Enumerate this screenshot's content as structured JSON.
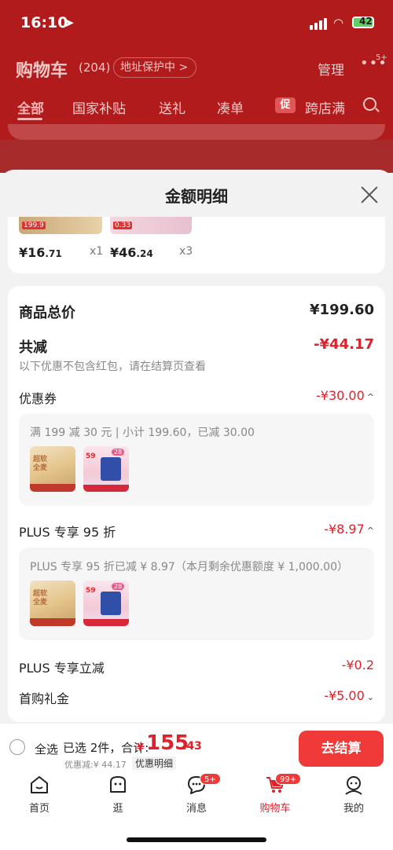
{
  "status": {
    "time": "16:10",
    "battery": "42"
  },
  "header": {
    "title": "购物车",
    "count": "(204)",
    "addr_pill": "地址保护中 >",
    "manage": "管理",
    "more_badge": "5+"
  },
  "tabs": [
    "全部",
    "国家补贴",
    "送礼",
    "凑单",
    "促",
    "跨店满"
  ],
  "sheet": {
    "title": "金额明细"
  },
  "items": [
    {
      "thumb_label": "199.9",
      "price_int": "¥16",
      "price_dec": ".71",
      "qty": "x1"
    },
    {
      "thumb_label": "0.33",
      "price_int": "¥46",
      "price_dec": ".24",
      "qty": "x3"
    }
  ],
  "summary": {
    "total_label": "商品总价",
    "total_value": "¥199.60",
    "reduce_label": "共减",
    "reduce_value": "-¥44.17",
    "reduce_note": "以下优惠不包含红包，请在结算页查看",
    "coupon_label": "优惠券",
    "coupon_value": "-¥30.00",
    "coupon_detail": "满 199 减 30 元 | 小计 199.60，已减 30.00",
    "plus_label": "PLUS 专享 95 折",
    "plus_value": "-¥8.97",
    "plus_detail": "PLUS 专享 95 折已减 ¥ 8.97（本月剩余优惠额度 ¥ 1,000.00）",
    "plus_cut_label": "PLUS 专享立减",
    "plus_cut_value": "-¥0.2",
    "first_gift_label": "首购礼金",
    "first_gift_value": "-¥5.00"
  },
  "product_thumbs": {
    "bread_text": "超软\n全麦",
    "milk_tag": "59",
    "milk_tag2": "28"
  },
  "bottom": {
    "select_all": "全选",
    "selected": "已选 2件，合计:",
    "total_sym": "¥",
    "total_int": "155",
    "total_dec": ".43",
    "discount": "优惠减:¥ 44.17",
    "detail_link": "优惠明细",
    "checkout": "去结算"
  },
  "tabbar": [
    {
      "label": "首页",
      "icon": "home-icon"
    },
    {
      "label": "逛",
      "icon": "browse-icon"
    },
    {
      "label": "消息",
      "icon": "message-icon",
      "badge": "5+"
    },
    {
      "label": "购物车",
      "icon": "cart-icon",
      "badge": "99+"
    },
    {
      "label": "我的",
      "icon": "profile-icon"
    }
  ],
  "colors": {
    "accent": "#e0202a",
    "header_bg": "#b11b1b",
    "checkout_bg": "#f03a3a"
  }
}
